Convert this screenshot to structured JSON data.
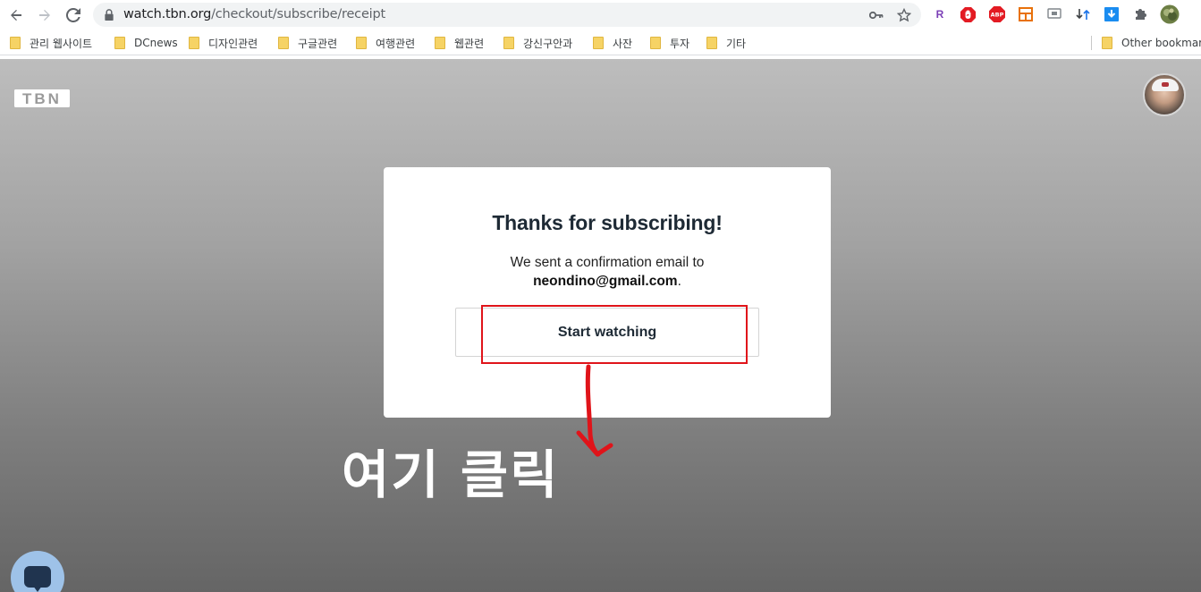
{
  "browser": {
    "url_host": "watch.tbn.org",
    "url_path": "/checkout/subscribe/receipt",
    "extensions": [
      "R",
      "ABP"
    ],
    "bookmarks": [
      {
        "label": "관리 웹사이트"
      },
      {
        "label": "DCnews"
      },
      {
        "label": "디자인관련"
      },
      {
        "label": "구글관련"
      },
      {
        "label": "여행관련"
      },
      {
        "label": "웹관련"
      },
      {
        "label": "강신구안과"
      },
      {
        "label": "사잔"
      },
      {
        "label": "투자"
      },
      {
        "label": "기타"
      }
    ],
    "other_bookmarks": "Other bookmarks"
  },
  "page": {
    "logo_text": "TBN",
    "card": {
      "title": "Thanks for subscribing!",
      "message": "We sent a confirmation email to",
      "email": "neondino@gmail.com",
      "email_suffix": ".",
      "button_label": "Start watching"
    },
    "annotation_text": "여기 클릭"
  },
  "colors": {
    "annotation_red": "#e0141a",
    "card_title": "#1e2a35",
    "chat_bubble": "#9ec2e8"
  }
}
